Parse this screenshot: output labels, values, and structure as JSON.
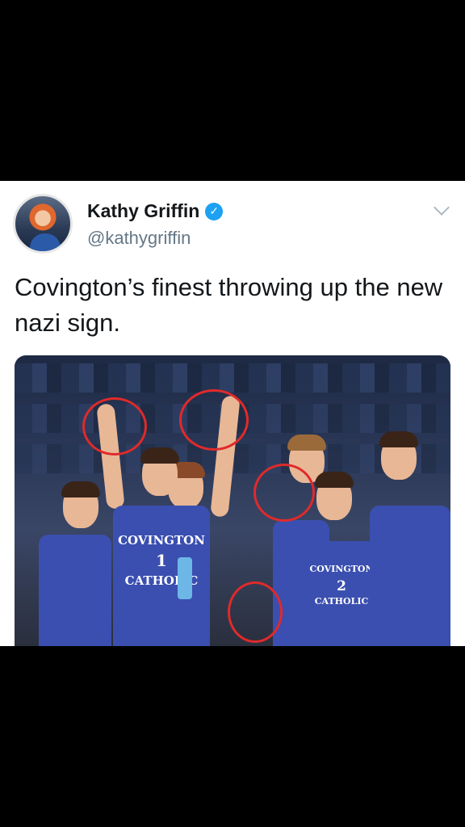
{
  "tweet": {
    "display_name": "Kathy Griffin",
    "handle": "@kathygriffin",
    "verified_icon": "verified-badge-icon",
    "text": "Covington’s finest throwing up the new nazi sign."
  },
  "photo": {
    "jerseys": [
      {
        "line1": "COVINGTON",
        "number": "1",
        "line2": "CATHOLIC"
      },
      {
        "line1": "COVINGTON",
        "number": "2",
        "line2": "CATHOLIC"
      }
    ],
    "annotation_color": "#e02a2a"
  },
  "colors": {
    "verified": "#1da1f2",
    "jersey": "#3b4fb0",
    "text": "#14171a",
    "handle": "#657786"
  }
}
